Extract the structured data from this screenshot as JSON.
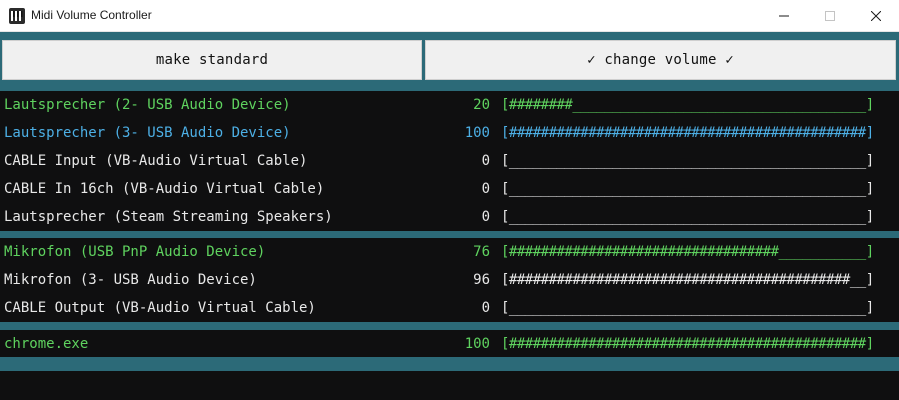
{
  "window": {
    "title": "Midi Volume Controller"
  },
  "buttons": {
    "make_standard": "make standard",
    "change_volume": "✓ change volume ✓"
  },
  "colors": {
    "active_green": "#5fd35f",
    "active_blue": "#4db0e6",
    "inactive": "#e8e8e8",
    "panel_bg": "#0f0f10",
    "separator": "#2c6a78"
  },
  "outputs": [
    {
      "name": "Lautsprecher (2- USB Audio Device)",
      "volume": 20,
      "bar": "[########_____________________________________]",
      "state": "green"
    },
    {
      "name": "Lautsprecher (3- USB Audio Device)",
      "volume": 100,
      "bar": "[#############################################]",
      "state": "blue"
    },
    {
      "name": "CABLE Input (VB-Audio Virtual Cable)",
      "volume": 0,
      "bar": "[_____________________________________________]",
      "state": "normal"
    },
    {
      "name": "CABLE In 16ch (VB-Audio Virtual Cable)",
      "volume": 0,
      "bar": "[_____________________________________________]",
      "state": "normal"
    },
    {
      "name": "Lautsprecher (Steam Streaming Speakers)",
      "volume": 0,
      "bar": "[_____________________________________________]",
      "state": "normal"
    }
  ],
  "inputs": [
    {
      "name": "Mikrofon (USB PnP Audio Device)",
      "volume": 76,
      "bar": "[##################################___________]",
      "state": "green"
    },
    {
      "name": "Mikrofon (3- USB Audio Device)",
      "volume": 96,
      "bar": "[###########################################__]",
      "state": "normal"
    },
    {
      "name": "CABLE Output (VB-Audio Virtual Cable)",
      "volume": 0,
      "bar": "[_____________________________________________]",
      "state": "normal"
    }
  ],
  "apps": [
    {
      "name": "chrome.exe",
      "volume": 100,
      "bar": "[#############################################]",
      "state": "green"
    }
  ],
  "input_field": {
    "value": ""
  }
}
